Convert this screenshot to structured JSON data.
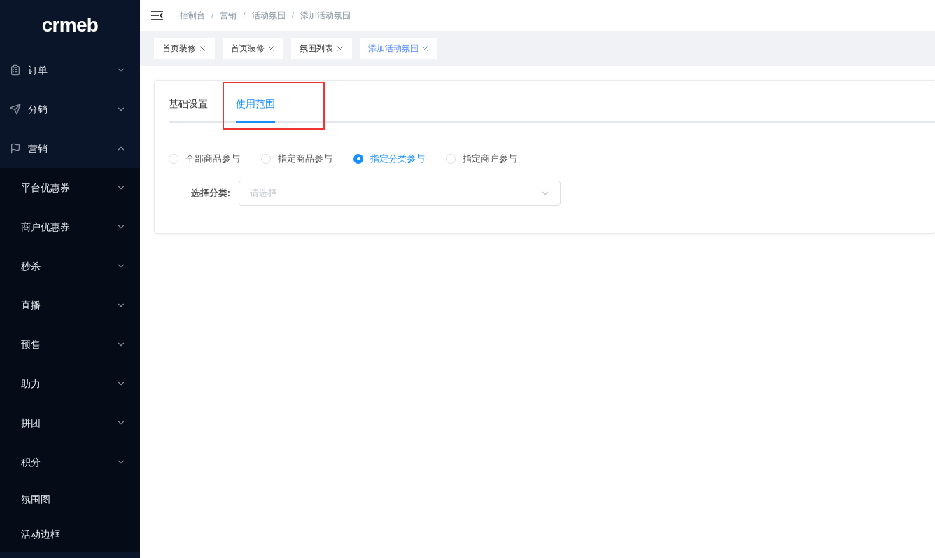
{
  "logo": "crmeb",
  "sidebar": {
    "items": [
      {
        "label": "订单",
        "kind": "orders",
        "expanded": false
      },
      {
        "label": "分销",
        "kind": "distribution",
        "expanded": false
      },
      {
        "label": "营销",
        "kind": "marketing",
        "expanded": true,
        "children": [
          {
            "label": "平台优惠券",
            "kind": "group"
          },
          {
            "label": "商户优惠券",
            "kind": "group"
          },
          {
            "label": "秒杀",
            "kind": "group"
          },
          {
            "label": "直播",
            "kind": "group"
          },
          {
            "label": "预售",
            "kind": "group"
          },
          {
            "label": "助力",
            "kind": "group"
          },
          {
            "label": "拼团",
            "kind": "group"
          },
          {
            "label": "积分",
            "kind": "group"
          },
          {
            "label": "氛围图",
            "kind": "link"
          },
          {
            "label": "活动边框",
            "kind": "link"
          }
        ]
      }
    ]
  },
  "breadcrumb": [
    {
      "label": "控制台"
    },
    {
      "separator": "/",
      "label": "营销"
    },
    {
      "separator": "/",
      "label": "活动氛围"
    },
    {
      "separator": "/",
      "label": "添加活动氛围"
    }
  ],
  "tags": [
    {
      "label": "首页装修",
      "selected": false
    },
    {
      "label": "首页装修",
      "selected": false
    },
    {
      "label": "氛围列表",
      "selected": false
    },
    {
      "label": "添加活动氛围",
      "selected": true
    }
  ],
  "tabs": [
    {
      "label": "基础设置",
      "selected": false,
      "highlighted": false
    },
    {
      "label": "使用范围",
      "selected": true,
      "highlighted": true
    }
  ],
  "scope_options": [
    {
      "label": "全部商品参与",
      "selected": false
    },
    {
      "label": "指定商品参与",
      "selected": false
    },
    {
      "label": "指定分类参与",
      "selected": true
    },
    {
      "label": "指定商户参与",
      "selected": false
    }
  ],
  "category_field": {
    "label": "选择分类:",
    "placeholder": "请选择"
  }
}
